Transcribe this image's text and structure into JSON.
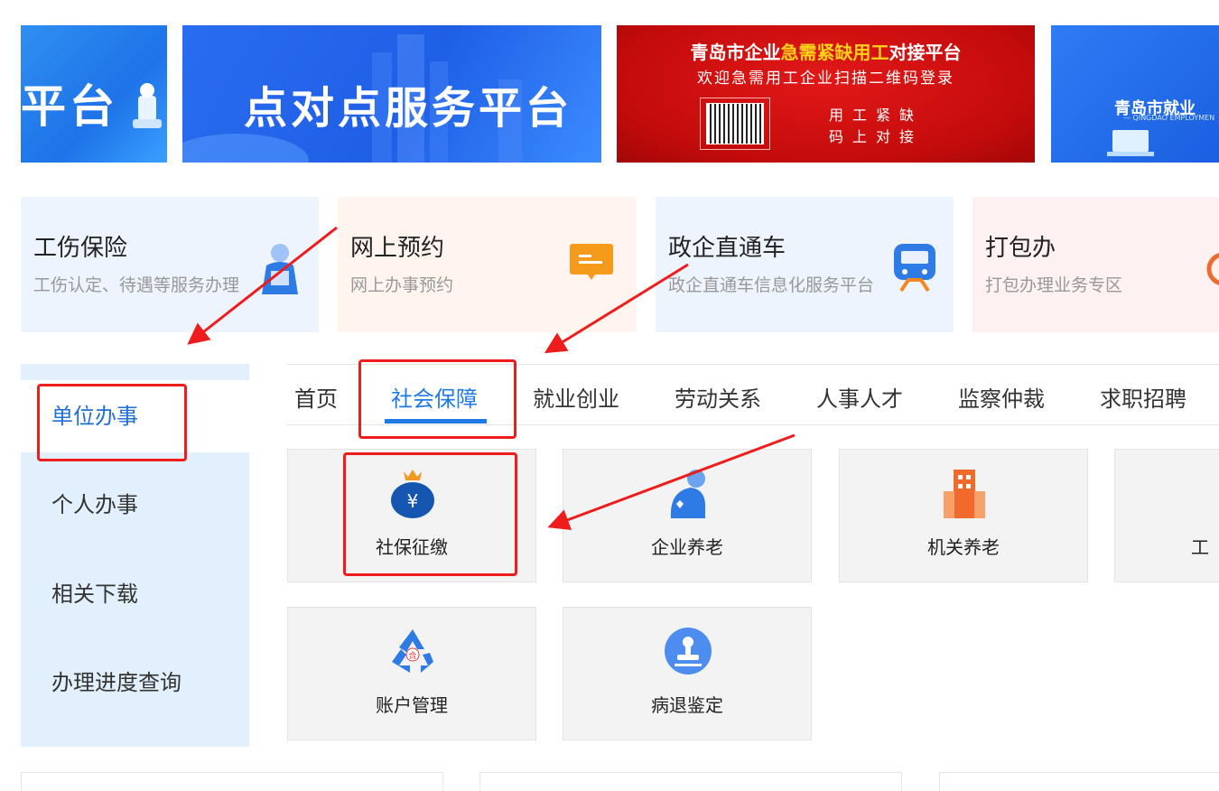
{
  "banners": [
    {
      "text": "平台"
    },
    {
      "text": "点对点服务平台"
    },
    {
      "line1_a": "青岛市企业",
      "line1_b": "急需紧缺用工",
      "line1_c": "对接平台",
      "line2": "欢迎急需用工企业扫描二维码登录",
      "line3": "用工紧缺",
      "line4": "码上对接"
    },
    {
      "text": "青岛市就业",
      "sub": "— QINGDAO EMPLOYMEN"
    }
  ],
  "services": [
    {
      "title": "工伤保险",
      "desc": "工伤认定、待遇等服务办理",
      "bg": "#eef4fd",
      "icon": "worker-icon"
    },
    {
      "title": "网上预约",
      "desc": "网上办事预约",
      "bg": "#fff5ee",
      "icon": "message-icon"
    },
    {
      "title": "政企直通车",
      "desc": "政企直通车信息化服务平台",
      "bg": "#eef4fd",
      "icon": "train-icon"
    },
    {
      "title": "打包办",
      "desc": "打包办理业务专区",
      "bg": "#fdf1f1",
      "icon": "package-icon"
    }
  ],
  "sidebar": {
    "items": [
      {
        "label": "单位办事",
        "active": true
      },
      {
        "label": "个人办事"
      },
      {
        "label": "相关下载"
      },
      {
        "label": "办理进度查询"
      }
    ]
  },
  "tabs": [
    {
      "label": "首页"
    },
    {
      "label": "社会保障",
      "active": true
    },
    {
      "label": "就业创业"
    },
    {
      "label": "劳动关系"
    },
    {
      "label": "人事人才"
    },
    {
      "label": "监察仲裁"
    },
    {
      "label": "求职招聘"
    }
  ],
  "tiles": [
    {
      "label": "社保征缴",
      "icon": "money-bag-icon"
    },
    {
      "label": "企业养老",
      "icon": "elderly-icon"
    },
    {
      "label": "机关养老",
      "icon": "building-icon"
    },
    {
      "label": "工",
      "icon": ""
    },
    {
      "label": "账户管理",
      "icon": "recycle-icon"
    },
    {
      "label": "病退鉴定",
      "icon": "stamp-icon"
    }
  ],
  "colors": {
    "accent": "#1f7ae8",
    "annotation": "#ee1c1c"
  }
}
